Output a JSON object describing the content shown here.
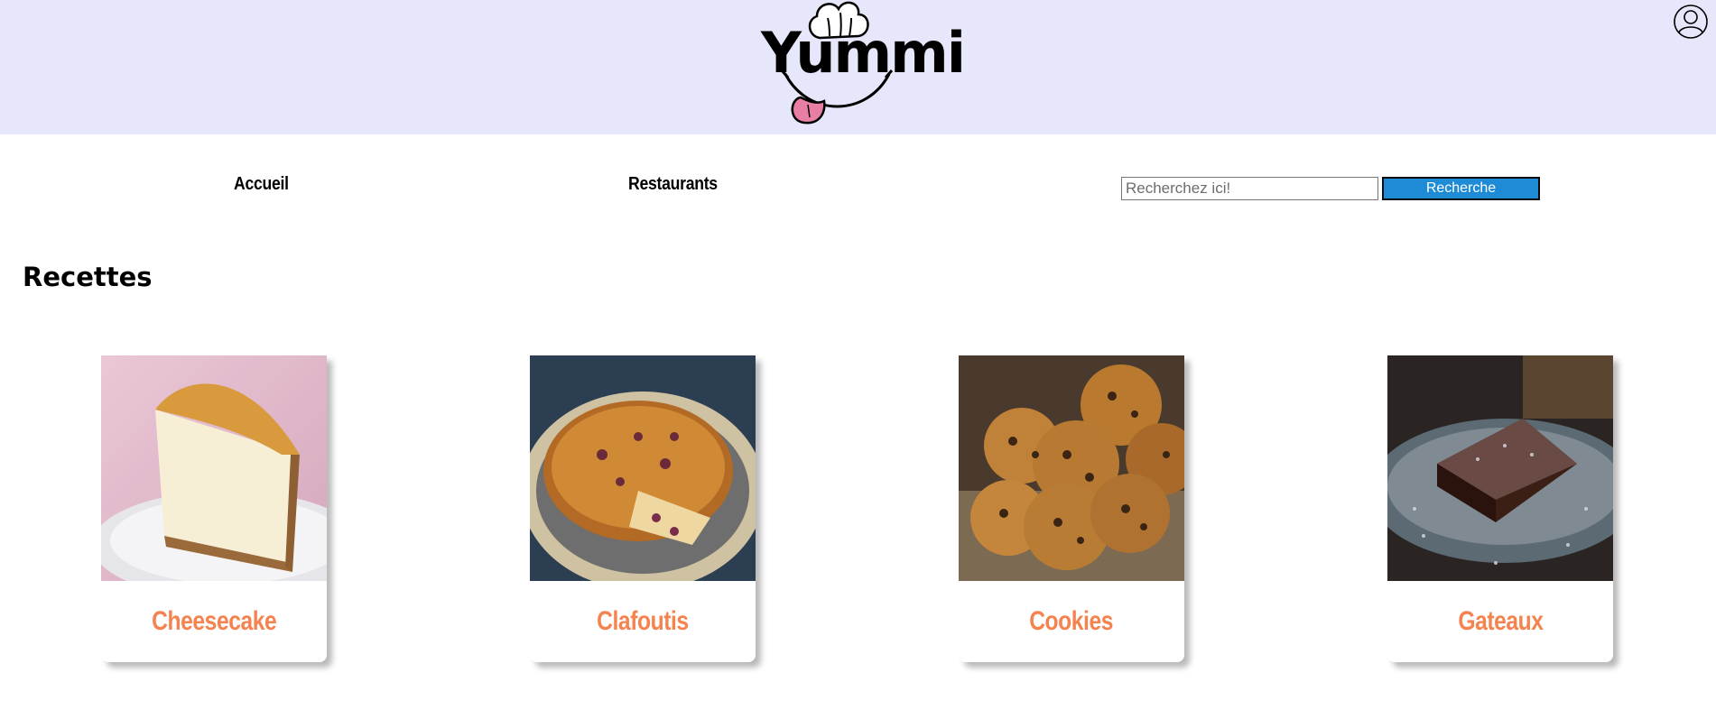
{
  "header": {
    "logo_text": "Yummi",
    "background_color": "#e6e7fa",
    "user_icon": "user-icon"
  },
  "nav": {
    "home_label": "Accueil",
    "restaurants_label": "Restaurants"
  },
  "search": {
    "placeholder": "Recherchez ici!",
    "value": "",
    "button_label": "Recherche",
    "button_color": "#1e8bd6"
  },
  "section": {
    "title": "Recettes"
  },
  "recipes": [
    {
      "name": "Cheesecake",
      "image": "cheesecake-photo"
    },
    {
      "name": "Clafoutis",
      "image": "clafoutis-photo"
    },
    {
      "name": "Cookies",
      "image": "cookies-photo"
    },
    {
      "name": "Gateaux",
      "image": "chocolate-cake-photo"
    }
  ],
  "colors": {
    "recipe_title": "#f5834f",
    "accent": "#1e8bd6"
  }
}
